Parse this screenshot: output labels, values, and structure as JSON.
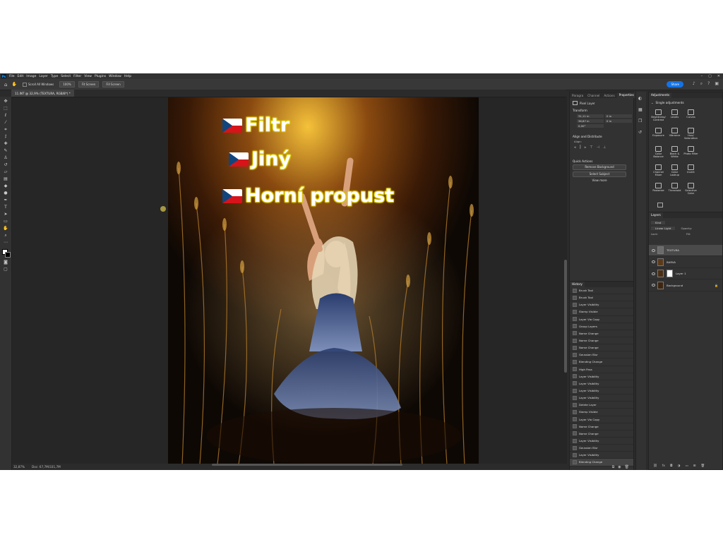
{
  "app": {
    "logo": "Ps",
    "menu": [
      "File",
      "Edit",
      "Image",
      "Layer",
      "Type",
      "Select",
      "Filter",
      "View",
      "Plugins",
      "Window",
      "Help"
    ],
    "share_label": "Share"
  },
  "options_bar": {
    "scroll_all_windows": "Scroll All Windows",
    "zoom_100": "100%",
    "fit_screen": "Fit Screen",
    "fill_screen": "Fill Screen"
  },
  "document": {
    "tab_title": "11.INT @ 32,9% (TEXTURA, RGB/8*) *",
    "zoom": "32,87%",
    "doc_info": "Doc: 67,7M/331,7M"
  },
  "canvas_text": {
    "line1": "Filtr",
    "line2": "Jiný",
    "line3": "Horní propust"
  },
  "properties": {
    "tabs": [
      "Paragra",
      "Channel",
      "Actions",
      "Properties"
    ],
    "kind": "Pixel Layer",
    "transform_title": "Transform",
    "w": "31,11 in",
    "h": "36,87 in",
    "x": "0 in",
    "y": "0 in",
    "angle": "0,00°",
    "align_title": "Align and Distribute",
    "align_label": "Align:",
    "quick_actions_title": "Quick Actions",
    "remove_bg": "Remove Background",
    "select_subject": "Select Subject",
    "view_more": "View more"
  },
  "history": {
    "title": "History",
    "items": [
      "Brush Tool",
      "Brush Tool",
      "Layer Visibility",
      "Stamp Visible",
      "Layer Via Copy",
      "Group Layers",
      "Name Change",
      "Name Change",
      "Name Change",
      "Gaussian Blur",
      "Blending Change",
      "High Pass",
      "Layer Visibility",
      "Layer Visibility",
      "Layer Visibility",
      "Layer Visibility",
      "Delete Layer",
      "Stamp Visible",
      "Layer Via Copy",
      "Name Change",
      "Name Change",
      "Layer Visibility",
      "Gaussian Blur",
      "Layer Visibility",
      "Blending Change"
    ]
  },
  "adjustments": {
    "title": "Adjustments",
    "single_title": "Single adjustments",
    "items": [
      "Brightness/ Contrast",
      "Levels",
      "Curves",
      "",
      "Exposure",
      "Vibrance",
      "Hue/ Saturation",
      "",
      "Color Balance",
      "Black & White",
      "Photo Filter",
      "",
      "Channel Mixer",
      "Color Lookup",
      "Invert",
      "",
      "Posterize",
      "Threshold",
      "Selective Color",
      ""
    ]
  },
  "layers": {
    "title": "Layers",
    "kind_label": "Kind",
    "blend_mode": "Linear Light",
    "opacity_label": "Opacity:",
    "fill_label": "Fill:",
    "lock_label": "Lock:",
    "items": [
      {
        "name": "TEXTURA",
        "color": "#6b6b6b"
      },
      {
        "name": "BARVA",
        "color": "#5a3a1a"
      },
      {
        "name": "Layer 1",
        "color": "#4a2f14"
      },
      {
        "name": "Background",
        "color": "#3d2610"
      }
    ]
  },
  "colors": {
    "app_bg": "#2b2b2b",
    "panel_bg": "#323232",
    "accent": "#1473e6",
    "text_glow": "#e8d800",
    "flag_blue": "#11457e",
    "flag_red": "#d7141a"
  },
  "icons": [
    "move-icon",
    "marquee-icon",
    "lasso-icon",
    "magic-wand-icon",
    "crop-icon",
    "eyedropper-icon",
    "healing-icon",
    "brush-icon",
    "stamp-icon",
    "history-brush-icon",
    "eraser-icon",
    "gradient-icon",
    "blur-icon",
    "dodge-icon",
    "pen-icon",
    "type-icon",
    "path-select-icon",
    "shape-icon",
    "hand-icon",
    "zoom-icon",
    "eye-icon",
    "lock-icon",
    "trash-icon",
    "camera-icon",
    "search-icon",
    "bell-icon",
    "help-icon"
  ]
}
